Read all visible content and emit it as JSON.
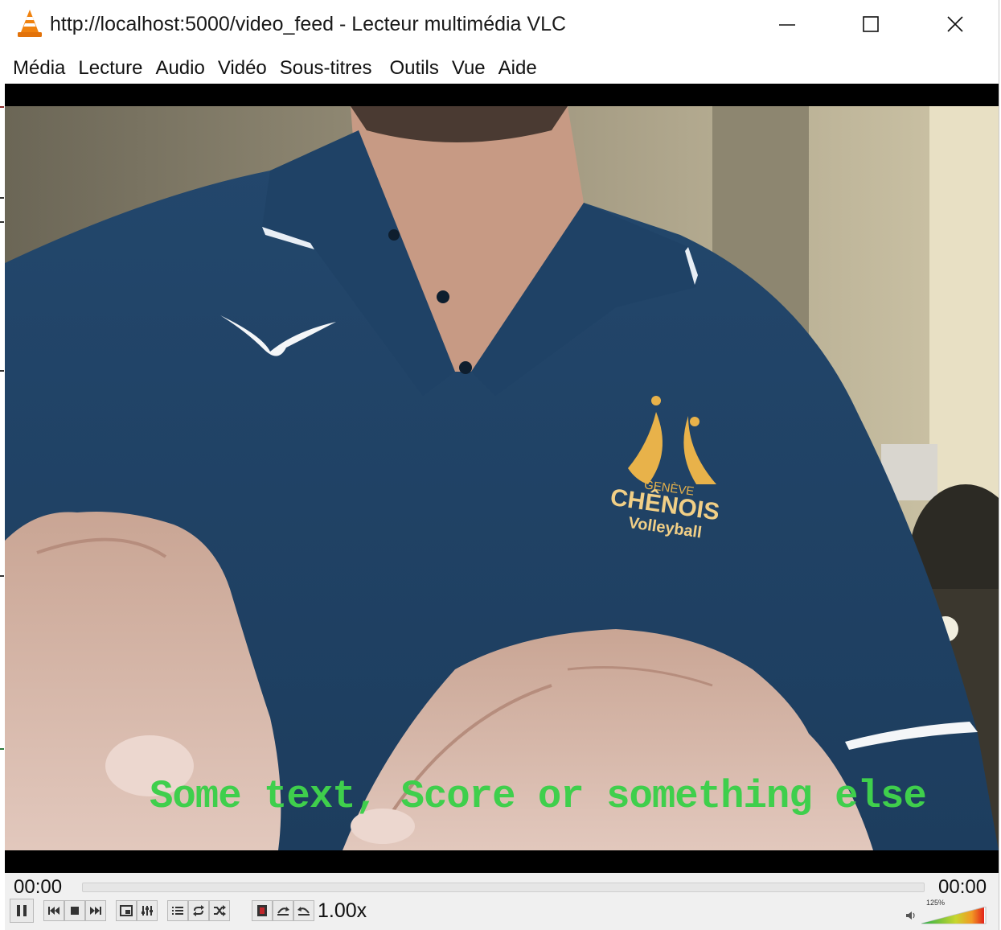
{
  "window": {
    "title": "http://localhost:5000/video_feed - Lecteur multimédia VLC",
    "app_icon": "vlc-cone-icon",
    "controls": [
      "minimize-icon",
      "maximize-icon",
      "close-icon"
    ]
  },
  "menu": [
    "Média",
    "Lecture",
    "Audio",
    "Vidéo",
    "Sous-titres",
    "Outils",
    "Vue",
    "Aide"
  ],
  "video": {
    "overlay_text": "Some text, Score or something else",
    "overlay_color": "#3fcf4c",
    "shirt_logo_lines": [
      "GENÈVE",
      "CHÊNOIS",
      "Volleyball"
    ]
  },
  "playback": {
    "elapsed": "00:00",
    "total": "00:00",
    "progress": 0,
    "speed": "1.00x",
    "volume_label": "125%",
    "volume": 1.25
  },
  "control_icons": [
    "pause-icon",
    "previous-icon",
    "stop-icon",
    "next-icon",
    "fullscreen-icon",
    "extended-settings-icon",
    "playlist-icon",
    "loop-icon",
    "shuffle-icon",
    "record-icon",
    "snapshot-icon",
    "frame-by-frame-icon",
    "speaker-icon"
  ]
}
